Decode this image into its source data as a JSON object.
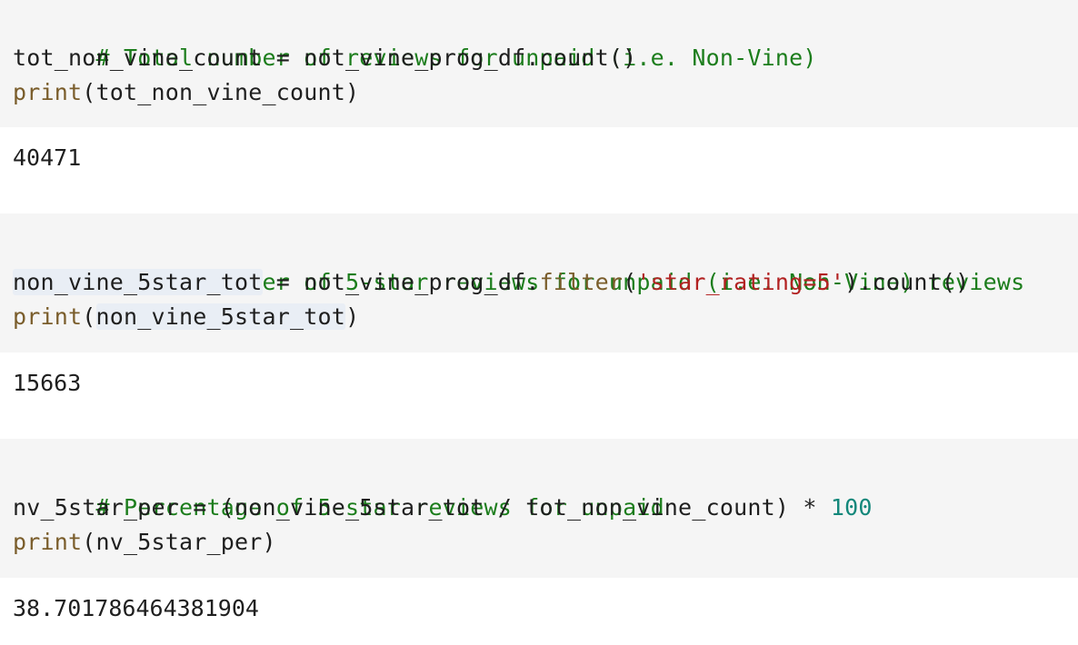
{
  "cells": [
    {
      "input": {
        "comment": "# Total number of reviews for unpaid (i.e. Non-Vine)",
        "line2": {
          "target": "tot_non_vine_count",
          "assign": " = ",
          "expr": "not_vine_prog_df.count()"
        },
        "line3": {
          "func": "print",
          "args": "(tot_non_vine_count)"
        }
      },
      "output": "40471"
    },
    {
      "input": {
        "comment": "# Total number of 5-star reviews for unpaid (i.e. Non-Vine) reviews",
        "line2": {
          "target": "non_vine_5star_tot",
          "assign": " = ",
          "obj": "not_vine_prog_df.",
          "method": "filter",
          "open": "(",
          "string": "'star_rating=5'",
          "close": ").count()"
        },
        "line3": {
          "func": "print",
          "open": "(",
          "arg": "non_vine_5star_tot",
          "close": ")"
        }
      },
      "output": "15663"
    },
    {
      "input": {
        "comment": "# Percentage of 5-star reviews for unpaid",
        "line2": {
          "target": "nv_5star_per",
          "expr": " = (non_vine_5star_tot / tot_non_vine_count) * ",
          "number": "100"
        },
        "line3": {
          "func": "print",
          "args": "(nv_5star_per)"
        }
      },
      "output": "38.701786464381904"
    }
  ],
  "colors": {
    "comment": "#1c7d1c",
    "builtin": "#7a5d2b",
    "string": "#b22222",
    "number": "#12877a",
    "input_bg": "#f5f5f5",
    "highlight": "#e9eef5"
  }
}
